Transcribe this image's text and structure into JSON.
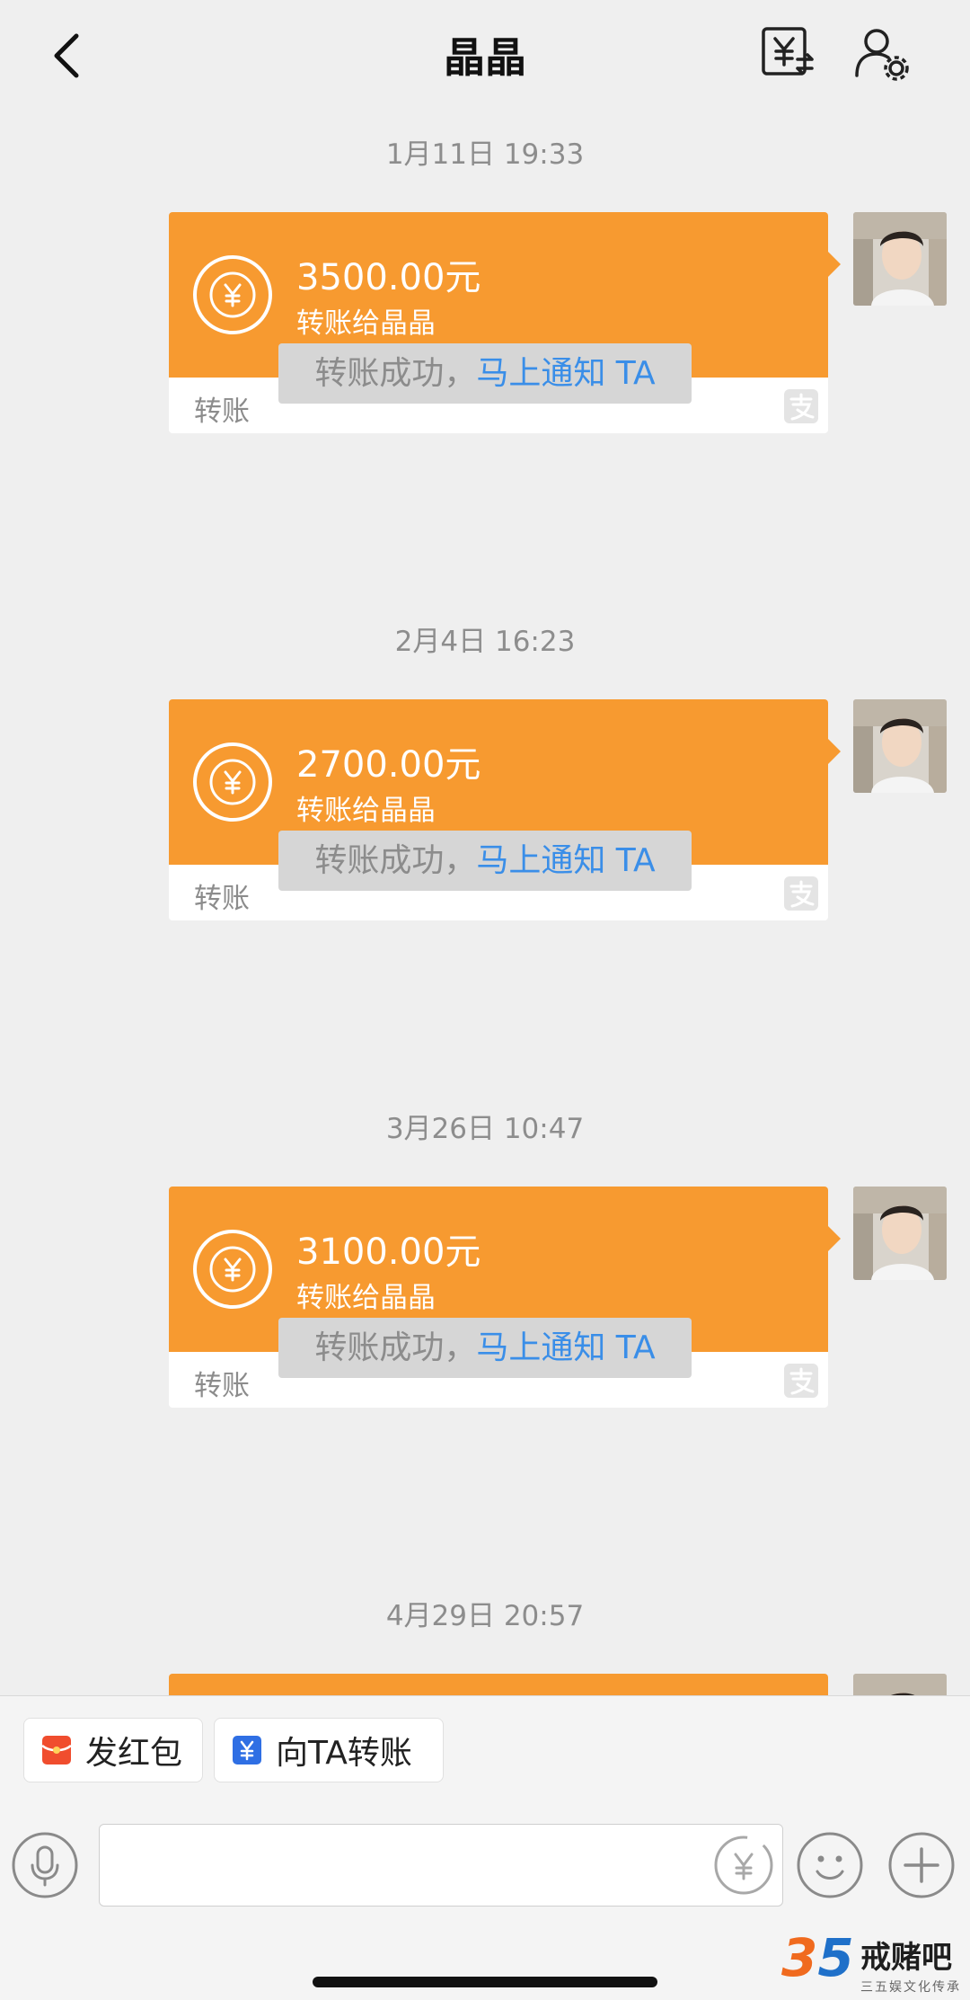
{
  "header": {
    "title": "晶晶",
    "back_icon": "chevron-left-icon",
    "transfer_icon": "yuan-transfer-icon",
    "settings_icon": "user-settings-icon"
  },
  "messages": [
    {
      "timestamp": "1月11日 19:33",
      "amount": "3500.00元",
      "subtitle": "转账给晶晶",
      "type": "转账",
      "notice_text": "转账成功，",
      "notice_link": "马上通知 TA"
    },
    {
      "timestamp": "2月4日 16:23",
      "amount": "2700.00元",
      "subtitle": "转账给晶晶",
      "type": "转账",
      "notice_text": "转账成功，",
      "notice_link": "马上通知 TA"
    },
    {
      "timestamp": "3月26日 10:47",
      "amount": "3100.00元",
      "subtitle": "转账给晶晶",
      "type": "转账",
      "notice_text": "转账成功，",
      "notice_link": "马上通知 TA"
    },
    {
      "timestamp": "4月29日 20:57"
    }
  ],
  "quick_actions": {
    "red_packet": "发红包",
    "transfer": "向TA转账"
  },
  "input": {
    "placeholder": ""
  },
  "colors": {
    "accent_orange": "#f79a30",
    "link_blue": "#3a8ee8",
    "background": "#efefef"
  },
  "watermark": {
    "number_a": "3",
    "number_b": "5",
    "name": "戒赌吧",
    "subtitle": "三五娱文化传承"
  }
}
